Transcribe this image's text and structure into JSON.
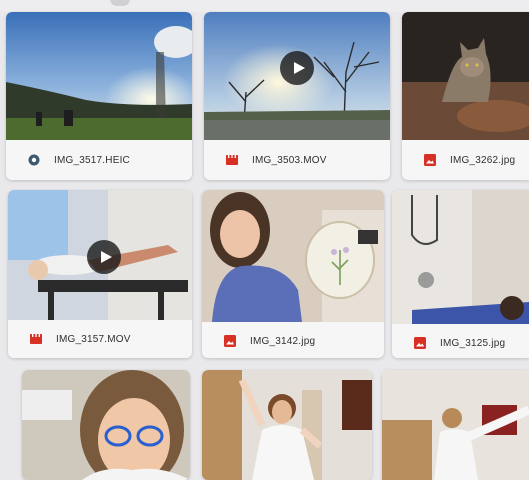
{
  "colors": {
    "video_icon": "#d93025",
    "image_icon": "#d93025",
    "heic_icon": "#3b5a72",
    "label_text": "#303030",
    "card_bg": "#f6f6f7"
  },
  "files": [
    {
      "name": "IMG_3517.HEIC",
      "type": "photo-heic",
      "icon": "photo-circle-icon"
    },
    {
      "name": "IMG_3503.MOV",
      "type": "video",
      "icon": "video-icon"
    },
    {
      "name": "IMG_3262.jpg",
      "type": "image",
      "icon": "image-icon"
    },
    {
      "name": "IMG_3157.MOV",
      "type": "video",
      "icon": "video-icon"
    },
    {
      "name": "IMG_3142.jpg",
      "type": "image",
      "icon": "image-icon"
    },
    {
      "name": "IMG_3125.jpg",
      "type": "image",
      "icon": "image-icon"
    },
    {
      "name": "",
      "type": "unknown",
      "icon": ""
    },
    {
      "name": "",
      "type": "unknown",
      "icon": ""
    },
    {
      "name": "",
      "type": "unknown",
      "icon": ""
    }
  ]
}
